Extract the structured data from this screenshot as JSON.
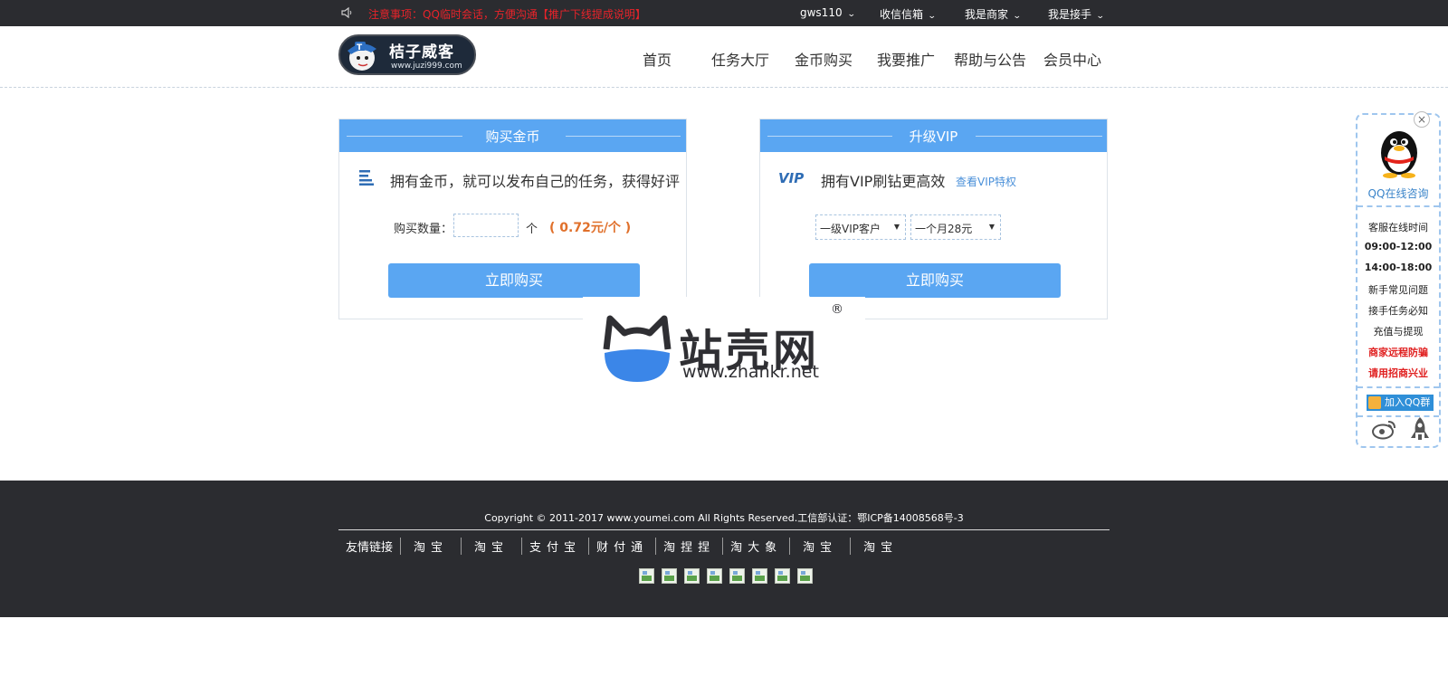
{
  "topbar": {
    "notice": "注意事项：QQ临时会话，方便沟通【推广下线提成说明】",
    "menus": [
      {
        "label": "gws110"
      },
      {
        "label": "收信信箱"
      },
      {
        "label": "我是商家"
      },
      {
        "label": "我是接手"
      }
    ]
  },
  "logo": {
    "title": "桔子威客",
    "url": "www.juzi999.com"
  },
  "nav": [
    "首页",
    "任务大厅",
    "金币购买",
    "我要推广",
    "帮助与公告",
    "会员中心"
  ],
  "buy_coins": {
    "title": "购买金币",
    "description": "拥有金币，就可以发布自己的任务，获得好评",
    "qty_label": "购买数量：",
    "qty_value": "",
    "unit": "个",
    "price": "( 0.72元/个 )",
    "button": "立即购买"
  },
  "vip": {
    "title": "升级VIP",
    "badge": "VIP",
    "description": "拥有VIP刷钻更高效",
    "link": "查看VIP特权",
    "level_selected": "一级VIP客户",
    "duration_selected": "一个月28元",
    "button": "立即购买"
  },
  "watermark": {
    "title": "站壳网",
    "reg": "®",
    "url": "www.zhankr.net"
  },
  "side": {
    "close": "×",
    "consult": "QQ在线咨询",
    "items": [
      {
        "label": "客服在线时间",
        "style": ""
      },
      {
        "label": "09:00-12:00",
        "style": "bold"
      },
      {
        "label": "14:00-18:00",
        "style": "bold"
      },
      {
        "label": "新手常见问题",
        "style": ""
      },
      {
        "label": "接手任务必知",
        "style": ""
      },
      {
        "label": "充值与提现",
        "style": ""
      },
      {
        "label": "商家远程防骗",
        "style": "red"
      },
      {
        "label": "请用招商兴业",
        "style": "red"
      }
    ],
    "join": "加入QQ群"
  },
  "footer": {
    "copyright": "Copyright © 2011-2017 www.youmei.com All Rights Reserved.工信部认证：鄂ICP备14008568号-3",
    "links_label": "友情链接",
    "links": [
      "淘宝",
      "淘宝",
      "支付宝",
      "财付通",
      "淘捏捏",
      "淘大象",
      "淘宝",
      "淘宝"
    ],
    "thumb_count": 8
  },
  "colors": {
    "topbar_bg": "#2b2c30",
    "accent": "#5aa6f2",
    "notice": "#e8232a",
    "price": "#e0702b"
  }
}
